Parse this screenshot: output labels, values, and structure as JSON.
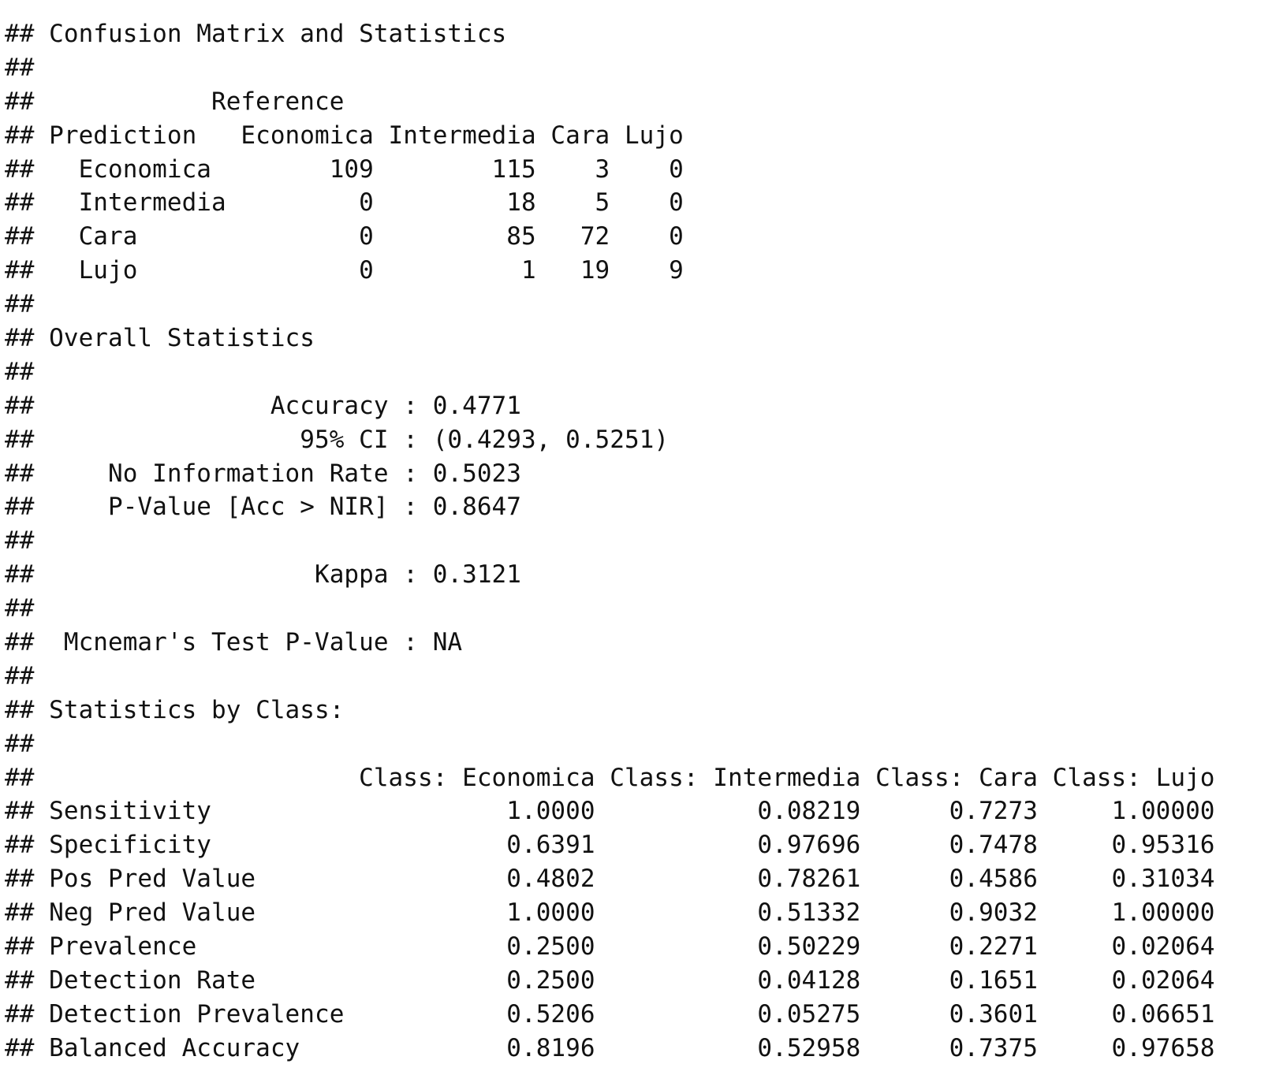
{
  "console_output": {
    "lines": [
      "## Confusion Matrix and Statistics",
      "##",
      "##            Reference",
      "## Prediction   Economica Intermedia Cara Lujo",
      "##   Economica        109        115    3    0",
      "##   Intermedia         0         18    5    0",
      "##   Cara               0         85   72    0",
      "##   Lujo               0          1   19    9",
      "##",
      "## Overall Statistics",
      "##",
      "##                Accuracy : 0.4771",
      "##                  95% CI : (0.4293, 0.5251)",
      "##     No Information Rate : 0.5023",
      "##     P-Value [Acc > NIR] : 0.8647",
      "##",
      "##                   Kappa : 0.3121",
      "##",
      "##  Mcnemar's Test P-Value : NA",
      "##",
      "## Statistics by Class:",
      "##",
      "##                      Class: Economica Class: Intermedia Class: Cara Class: Lujo",
      "## Sensitivity                    1.0000           0.08219      0.7273     1.00000",
      "## Specificity                    0.6391           0.97696      0.7478     0.95316",
      "## Pos Pred Value                 0.4802           0.78261      0.4586     0.31034",
      "## Neg Pred Value                 1.0000           0.51332      0.9032     1.00000",
      "## Prevalence                     0.2500           0.50229      0.2271     0.02064",
      "## Detection Rate                 0.2500           0.04128      0.1651     0.02064",
      "## Detection Prevalence           0.5206           0.05275      0.3601     0.06651",
      "## Balanced Accuracy              0.8196           0.52958      0.7375     0.97658"
    ]
  }
}
